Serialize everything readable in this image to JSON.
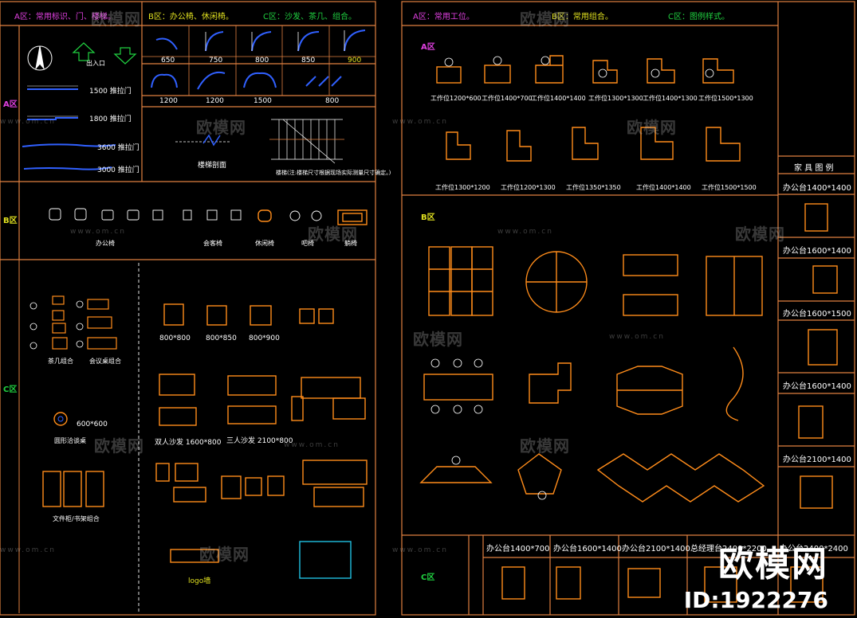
{
  "colors": {
    "frame": "#e08040",
    "furniture": "#ff8c1a",
    "accent_blue": "#3060ff",
    "cyan": "#20c0e0",
    "green": "#20d040",
    "magenta": "#e040e0",
    "yellow": "#e0e020",
    "white": "#ffffff"
  },
  "left_sheet": {
    "header_a": "A区：常用标识、门、楼梯。",
    "header_b": "B区：办公椅、休闲椅。",
    "header_c": "C区：沙发、茶几、组合。",
    "zone_a": "A区",
    "zone_b": "B区",
    "zone_c": "C区",
    "door_sizes_row1": [
      "650",
      "750",
      "800",
      "850",
      "900"
    ],
    "door_sizes_row2": [
      "1200",
      "1200",
      "1500",
      "800"
    ],
    "sliding_doors": [
      "1500 推拉门",
      "1800 推拉门",
      "3600 推拉门",
      "3000 推拉门"
    ],
    "entry_label": "出入口",
    "stair_label": "楼梯剖面",
    "stair_note": "楼梯(注:楼梯尺寸根据现场实际测量尺寸确定。)",
    "chair_labels": [
      "办公椅",
      "会客椅",
      "休闲椅",
      "吧椅",
      "躺椅"
    ],
    "table_labels": [
      "茶几组合",
      "会议桌组合"
    ],
    "sofa_single_sizes": [
      "800*800",
      "800*850",
      "800*900"
    ],
    "sofa_labels": [
      "双人沙发 1600*800",
      "三人沙发 2100*800"
    ],
    "round_table_label": "600*600",
    "round_table_name": "圆形洽谈桌",
    "cabinet_label": "文件柜/书架组合",
    "logo_label": "logo墙"
  },
  "right_sheet": {
    "header_a": "A区：常用工位。",
    "header_b": "B区：常用组合。",
    "header_c": "C区：图例样式。",
    "zone_a": "A区",
    "zone_b": "B区",
    "zone_c": "C区",
    "desk_labels_row1": [
      "工作位1200*600",
      "工作位1400*700",
      "工作位1400*1400",
      "工作位1300*1300",
      "工作位1400*1300",
      "工作位1500*1300"
    ],
    "desk_labels_row2": [
      "工作位1300*1200",
      "工作位1200*1300",
      "工作位1350*1350",
      "工作位1400*1400",
      "工作位1500*1500"
    ],
    "legend_title": "家 具 图 例",
    "legend_items": [
      "办公台1400*1400",
      "办公台1600*1400",
      "办公台1600*1500",
      "办公台1600*1400",
      "办公台2100*1400"
    ],
    "bottom_items": [
      "办公台1400*700",
      "办公台1600*1400",
      "办公台2100*1400",
      "总经理台2400*2200",
      "办公台2400*2400"
    ]
  },
  "watermark": {
    "brand": "欧模网",
    "domain": "www.om.cn",
    "big_brand": "欧模网",
    "id_text": "ID:1922276"
  }
}
